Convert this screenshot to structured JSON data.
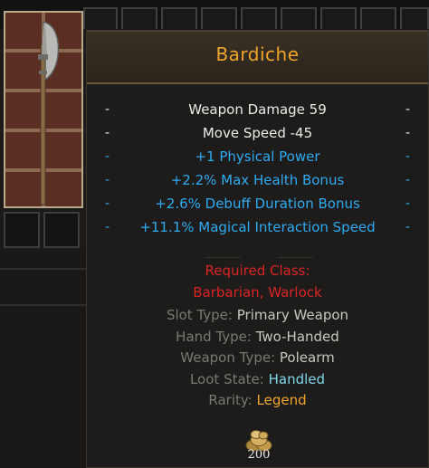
{
  "item": {
    "name": "Bardiche",
    "icon": "bardiche-polearm-icon"
  },
  "stats_primary": [
    {
      "text": "Weapon Damage 59",
      "dash": "-"
    },
    {
      "text": "Move Speed -45",
      "dash": "-"
    }
  ],
  "stats_bonus": [
    {
      "text": "+1 Physical Power",
      "dash": "-"
    },
    {
      "text": "+2.2% Max Health Bonus",
      "dash": "-"
    },
    {
      "text": "+2.6% Debuff Duration Bonus",
      "dash": "-"
    },
    {
      "text": "+11.1% Magical Interaction Speed",
      "dash": "-"
    }
  ],
  "requirements": {
    "label": "Required Class:",
    "classes": "Barbarian, Warlock"
  },
  "details": [
    {
      "label": "Slot Type:",
      "value": "Primary Weapon"
    },
    {
      "label": "Hand Type:",
      "value": "Two-Handed"
    },
    {
      "label": "Weapon Type:",
      "value": "Polearm"
    },
    {
      "label": "Loot State:",
      "value": "Handled"
    },
    {
      "label": "Rarity:",
      "value": "Legend"
    }
  ],
  "price": {
    "value": "200",
    "icon": "gold-coins-icon"
  },
  "colors": {
    "name": "#f0a52a",
    "bonus_stat": "#2eaaf0",
    "required": "#d92424",
    "loot_state": "#7fd6e8",
    "rarity": "#f0a52a"
  }
}
